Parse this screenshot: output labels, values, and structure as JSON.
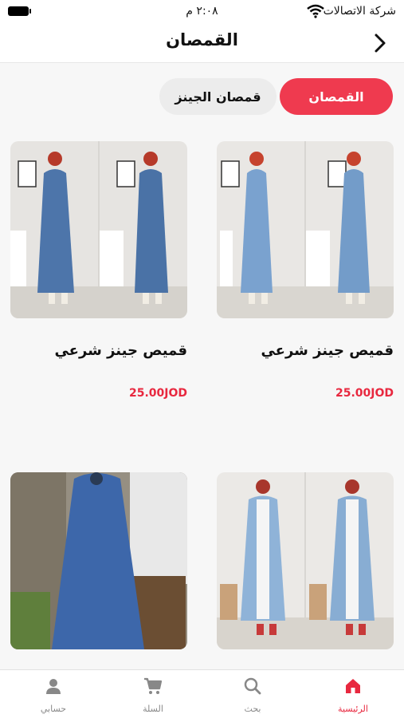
{
  "status_bar": {
    "carrier": "شركة الاتصالات",
    "time": "٢:٠٨ م"
  },
  "header": {
    "title": "القمصان"
  },
  "tabs": [
    {
      "label": "القمصان",
      "active": true
    },
    {
      "label": "قمصان الجينز",
      "active": false
    }
  ],
  "products": [
    {
      "name": "قميص جينز شرعي",
      "price": "25.00JOD"
    },
    {
      "name": "قميص جينز شرعي",
      "price": "25.00JOD"
    },
    {
      "name": "",
      "price": ""
    },
    {
      "name": "",
      "price": ""
    }
  ],
  "bottom_nav": [
    {
      "label": "الرئيسية",
      "icon": "home-icon",
      "active": true
    },
    {
      "label": "بحث",
      "icon": "search-icon",
      "active": false
    },
    {
      "label": "السلة",
      "icon": "cart-icon",
      "active": false
    },
    {
      "label": "حسابي",
      "icon": "account-icon",
      "active": false
    }
  ],
  "colors": {
    "accent": "#ef3a4f",
    "price": "#e8283f",
    "inactive_tab": "#ececec"
  }
}
